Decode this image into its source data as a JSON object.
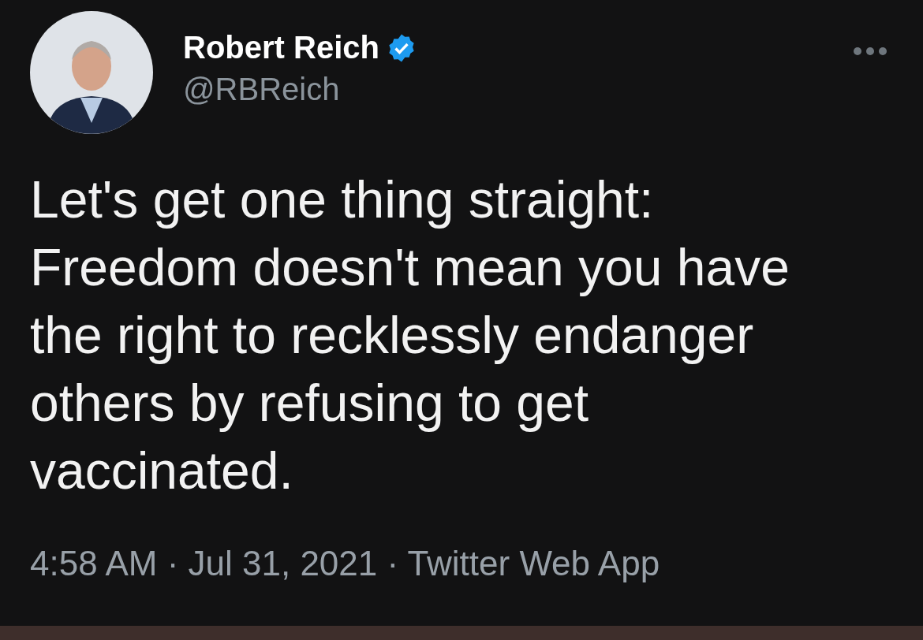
{
  "author": {
    "name": "Robert Reich",
    "handle": "@RBReich",
    "verified": true
  },
  "tweet": {
    "text_lines": [
      "Let's get one thing straight:",
      "Freedom doesn't mean you have",
      "the right to recklessly endanger",
      "others by refusing to get",
      "vaccinated."
    ],
    "meta": "4:58 AM · Jul 31, 2021 · Twitter Web App"
  }
}
